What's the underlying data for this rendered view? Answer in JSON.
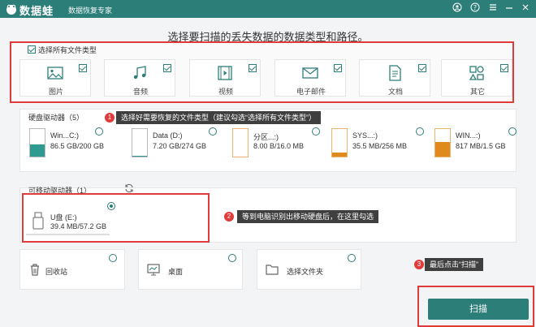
{
  "app": {
    "brand": "数据蛙",
    "subtitle": "数据恢复专家"
  },
  "window_controls": [
    "user-icon",
    "help-icon",
    "menu-icon",
    "minimize-icon",
    "close-icon"
  ],
  "heading": "选择要扫描的丢失数据的数据类型和路径。",
  "file_types": {
    "select_all_label": "选择所有文件类型",
    "select_all_checked": true,
    "items": [
      {
        "label": "图片",
        "icon": "image-icon",
        "checked": true
      },
      {
        "label": "音频",
        "icon": "music-icon",
        "checked": true
      },
      {
        "label": "视频",
        "icon": "video-icon",
        "checked": true
      },
      {
        "label": "电子邮件",
        "icon": "email-icon",
        "checked": true
      },
      {
        "label": "文档",
        "icon": "document-icon",
        "checked": true
      },
      {
        "label": "其它",
        "icon": "other-icon",
        "checked": true
      }
    ]
  },
  "hard_drives": {
    "title": "硬盘驱动器（5）",
    "items": [
      {
        "name": "Win...C:)",
        "size": "86.5 GB/200 GB",
        "fill": 0.43,
        "color": "#2f9a8f"
      },
      {
        "name": "Data (D:)",
        "size": "7.20 GB/274 GB",
        "fill": 0.03,
        "color": "#2f9a8f"
      },
      {
        "name": "分区...:)",
        "size": "8.00 B/16.0 MB",
        "fill": 0.0,
        "color": "#e08a1e"
      },
      {
        "name": "SYS...:)",
        "size": "35.5 MB/256 MB",
        "fill": 0.14,
        "color": "#e08a1e"
      },
      {
        "name": "WIN...:)",
        "size": "817 MB/1.5 GB",
        "fill": 0.53,
        "color": "#e08a1e"
      }
    ]
  },
  "removable": {
    "title": "可移动驱动器（1）",
    "items": [
      {
        "name": "U盘 (E:)",
        "size": "39.4 MB/57.2 GB",
        "selected": true
      }
    ]
  },
  "locations": [
    {
      "label": "回收站",
      "icon": "recycle-bin-icon"
    },
    {
      "label": "桌面",
      "icon": "desktop-icon"
    },
    {
      "label": "选择文件夹",
      "icon": "folder-icon"
    }
  ],
  "tips": [
    {
      "num": "1",
      "text": "选择好需要恢复的文件类型（建议勾选“选择所有文件类型”）"
    },
    {
      "num": "2",
      "text": "等到电脑识别出移动硬盘后，在这里勾选"
    },
    {
      "num": "3",
      "text": "最后点击“扫描”"
    }
  ],
  "scan_button": "扫描",
  "colors": {
    "primary": "#2c7e79",
    "highlight": "#e03b3b",
    "warning": "#e08a1e"
  }
}
